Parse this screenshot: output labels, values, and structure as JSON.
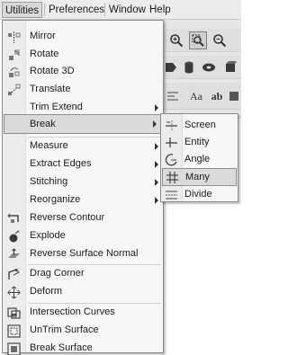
{
  "menubar": {
    "items": [
      "Utilities",
      "Preferences",
      "Window",
      "Help"
    ]
  },
  "toolbar": {
    "aa_label": "Aa",
    "ab_label": "ab"
  },
  "utilities_menu": {
    "items": [
      {
        "label": "Mirror",
        "icon": "mirror-icon"
      },
      {
        "label": "Rotate",
        "icon": "rotate-icon"
      },
      {
        "label": "Rotate 3D",
        "icon": "rotate-3d-icon"
      },
      {
        "label": "Translate",
        "icon": "translate-icon"
      },
      {
        "label": "Trim Extend",
        "icon": "none",
        "submenu": true
      },
      {
        "label": "Break",
        "icon": "none",
        "submenu": true,
        "selected": true
      },
      {
        "label": "Measure",
        "icon": "none",
        "submenu": true
      },
      {
        "label": "Extract Edges",
        "icon": "none",
        "submenu": true
      },
      {
        "label": "Stitching",
        "icon": "none",
        "submenu": true
      },
      {
        "label": "Reorganize",
        "icon": "none",
        "submenu": true
      },
      {
        "label": "Reverse Contour",
        "icon": "reverse-contour-icon"
      },
      {
        "label": "Explode",
        "icon": "explode-icon"
      },
      {
        "label": "Reverse Surface Normal",
        "icon": "reverse-normal-icon"
      },
      {
        "label": "Drag Corner",
        "icon": "drag-corner-icon"
      },
      {
        "label": "Deform",
        "icon": "deform-icon"
      },
      {
        "label": "Intersection Curves",
        "icon": "intersection-curves-icon"
      },
      {
        "label": "UnTrim Surface",
        "icon": "untrim-surface-icon"
      },
      {
        "label": "Break Surface",
        "icon": "break-surface-icon"
      }
    ]
  },
  "break_submenu": {
    "items": [
      {
        "label": "Screen",
        "icon": "screen-break-icon"
      },
      {
        "label": "Entity",
        "icon": "entity-break-icon"
      },
      {
        "label": "Angle",
        "icon": "angle-break-icon"
      },
      {
        "label": "Many",
        "icon": "many-break-icon",
        "selected": true
      },
      {
        "label": "Divide",
        "icon": "divide-break-icon"
      }
    ]
  }
}
